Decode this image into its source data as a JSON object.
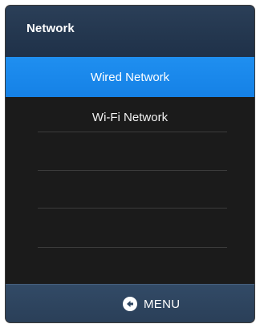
{
  "header": {
    "title": "Network"
  },
  "menu": {
    "items": [
      {
        "label": "Wired Network",
        "selected": true
      },
      {
        "label": "Wi-Fi Network",
        "selected": false
      },
      {
        "label": "",
        "selected": false
      },
      {
        "label": "",
        "selected": false
      },
      {
        "label": "",
        "selected": false
      },
      {
        "label": "",
        "selected": false
      }
    ]
  },
  "footer": {
    "menu_label": "MENU",
    "menu_icon": "back-arrow-icon"
  },
  "colors": {
    "accent": "#1b88ec",
    "title_bar": "#24374f",
    "list_background": "#1b1b1b",
    "footer": "#2e4560"
  }
}
